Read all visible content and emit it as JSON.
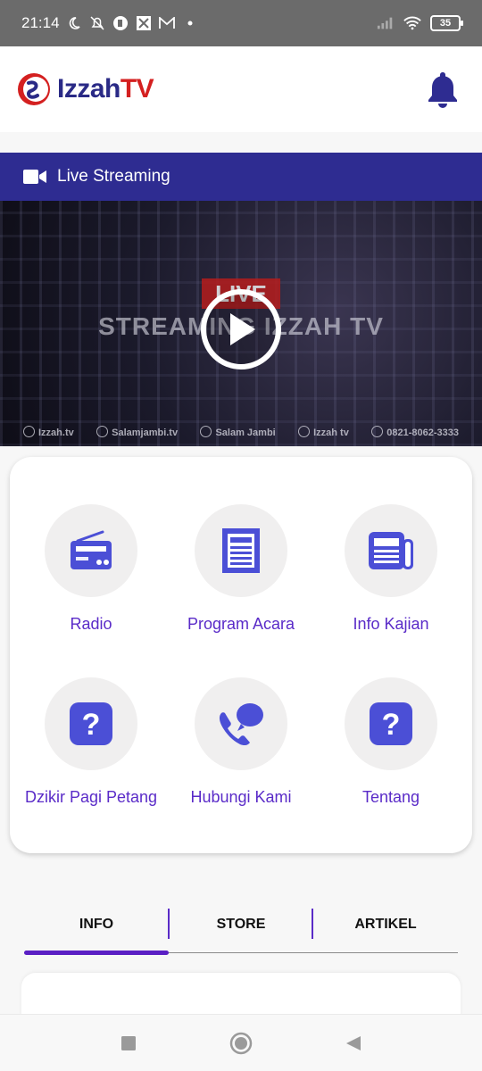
{
  "status_bar": {
    "time": "21:14",
    "battery": "35",
    "icons": [
      "moon-icon",
      "bell-off-icon",
      "app-icon",
      "app-icon-2",
      "gmail-icon",
      "dot-icon",
      "signal-icon",
      "wifi-icon",
      "battery-icon"
    ]
  },
  "header": {
    "logo_main": "Izzah",
    "logo_tv": "TV",
    "bell_icon": "bell-icon"
  },
  "live_bar": {
    "label": "Live Streaming",
    "icon": "video-camera-icon"
  },
  "video": {
    "tag": "LIVE",
    "title": "STREAMING IZZAH TV",
    "social": [
      {
        "icon": "globe-icon",
        "text": "Izzah.tv"
      },
      {
        "icon": "instagram-icon",
        "text": "Salamjambi.tv"
      },
      {
        "icon": "facebook-icon",
        "text": "Salam Jambi"
      },
      {
        "icon": "youtube-icon",
        "text": "Izzah tv"
      },
      {
        "icon": "whatsapp-icon",
        "text": "0821-8062-3333"
      }
    ]
  },
  "menu": {
    "items": [
      {
        "label": "Radio",
        "icon": "radio-icon"
      },
      {
        "label": "Program Acara",
        "icon": "document-icon"
      },
      {
        "label": "Info Kajian",
        "icon": "newspaper-icon"
      },
      {
        "label": "Dzikir Pagi Petang",
        "icon": "question-icon"
      },
      {
        "label": "Hubungi Kami",
        "icon": "phone-chat-icon"
      },
      {
        "label": "Tentang",
        "icon": "question-icon"
      }
    ]
  },
  "tabs": {
    "items": [
      "INFO",
      "STORE",
      "ARTIKEL"
    ],
    "active": "INFO"
  },
  "colors": {
    "brand_blue": "#2e2c91",
    "accent_purple": "#5a2bc8",
    "icon_blue": "#4b4fd6"
  }
}
